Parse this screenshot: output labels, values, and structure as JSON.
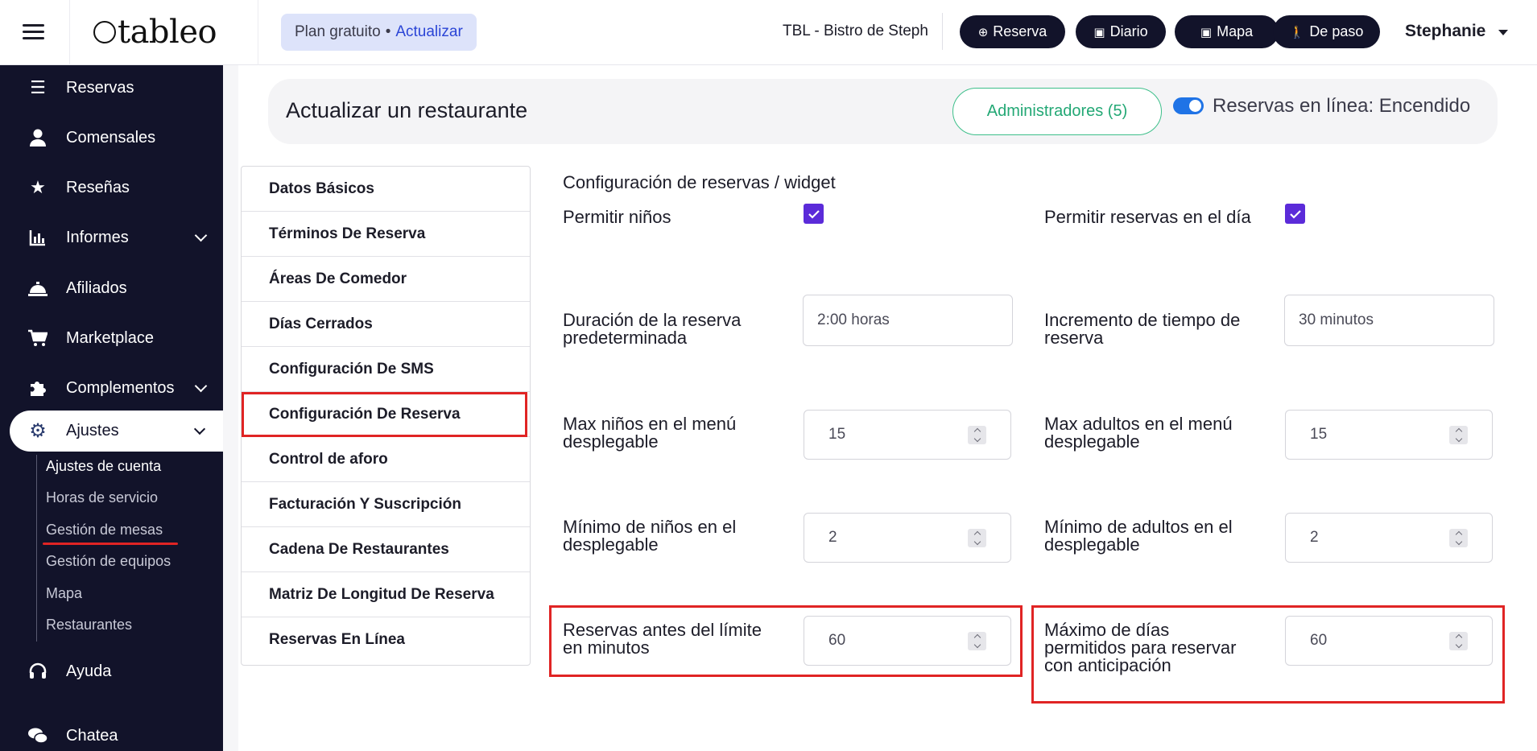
{
  "topbar": {
    "logo_text": "tableo",
    "plan": {
      "label": "Plan gratuito",
      "separator": "•",
      "upgrade": "Actualizar"
    },
    "restaurant_name": "TBL - Bistro de Steph",
    "buttons": [
      {
        "icon": "plus-circle-icon",
        "label": "Reserva"
      },
      {
        "icon": "calendar-icon",
        "label": "Diario"
      },
      {
        "icon": "calendar-icon",
        "label": "Mapa"
      },
      {
        "icon": "walk-icon",
        "label": "De paso"
      }
    ],
    "user_name": "Stephanie"
  },
  "sidebar": {
    "items": [
      {
        "label": "Reservas",
        "icon": "list-icon"
      },
      {
        "label": "Comensales",
        "icon": "user-icon"
      },
      {
        "label": "Reseñas",
        "icon": "star-icon"
      },
      {
        "label": "Informes",
        "icon": "chart-icon",
        "expandable": true
      },
      {
        "label": "Afiliados",
        "icon": "bell-icon"
      },
      {
        "label": "Marketplace",
        "icon": "cart-icon"
      },
      {
        "label": "Complementos",
        "icon": "puzzle-icon",
        "expandable": true
      }
    ],
    "active": {
      "label": "Ajustes",
      "icon": "gear-icon"
    },
    "sub_items": [
      "Ajustes de cuenta",
      "Horas de servicio",
      "Gestión de mesas",
      "Gestión de equipos",
      "Mapa",
      "Restaurantes"
    ],
    "active_sub": "Ajustes de cuenta",
    "bottom_items": [
      {
        "label": "Ayuda",
        "icon": "headset-icon"
      },
      {
        "label": "Chatea",
        "icon": "chat-icon"
      }
    ]
  },
  "header": {
    "title": "Actualizar un restaurante",
    "admins_button": "Administradores (5)",
    "online_toggle_label": "Reservas en línea: Encendido",
    "online_toggle_on": true
  },
  "tabs": [
    "Datos Básicos",
    "Términos De Reserva",
    "Áreas De Comedor",
    "Días Cerrados",
    "Configuración De SMS",
    "Configuración De Reserva",
    "Control de aforo",
    "Facturación Y Suscripción",
    "Cadena De Restaurantes",
    "Matriz De Longitud De Reserva",
    "Reservas En Línea"
  ],
  "active_tab": "Configuración De Reserva",
  "settings": {
    "section_title": "Configuración de reservas / widget",
    "allow_children": {
      "label": "Permitir niños",
      "checked": true
    },
    "allow_same_day": {
      "label": "Permitir reservas en el día",
      "checked": true
    },
    "default_duration": {
      "label": "Duración de la reserva predeterminada",
      "value": "2:00 horas"
    },
    "time_increment": {
      "label": "Incremento de tiempo de reserva",
      "value": "30 minutos"
    },
    "max_children": {
      "label": "Max niños en el menú desplegable",
      "value": "15"
    },
    "max_adults": {
      "label": "Max adultos en el menú desplegable",
      "value": "15"
    },
    "min_children": {
      "label": "Mínimo de niños en el desplegable",
      "value": "2"
    },
    "min_adults": {
      "label": "Mínimo de adultos en el desplegable",
      "value": "2"
    },
    "cutoff_minutes": {
      "label": "Reservas antes del límite en minutos",
      "value": "60"
    },
    "max_advance_days": {
      "label": "Máximo de días permitidos para reservar con anticipación",
      "value": "60"
    }
  },
  "colors": {
    "sidebar_bg": "#12132a",
    "accent_checkbox": "#5b2bd9",
    "admin_green": "#23a875",
    "toggle_blue": "#1f73e6",
    "highlight_red": "#e02424"
  }
}
